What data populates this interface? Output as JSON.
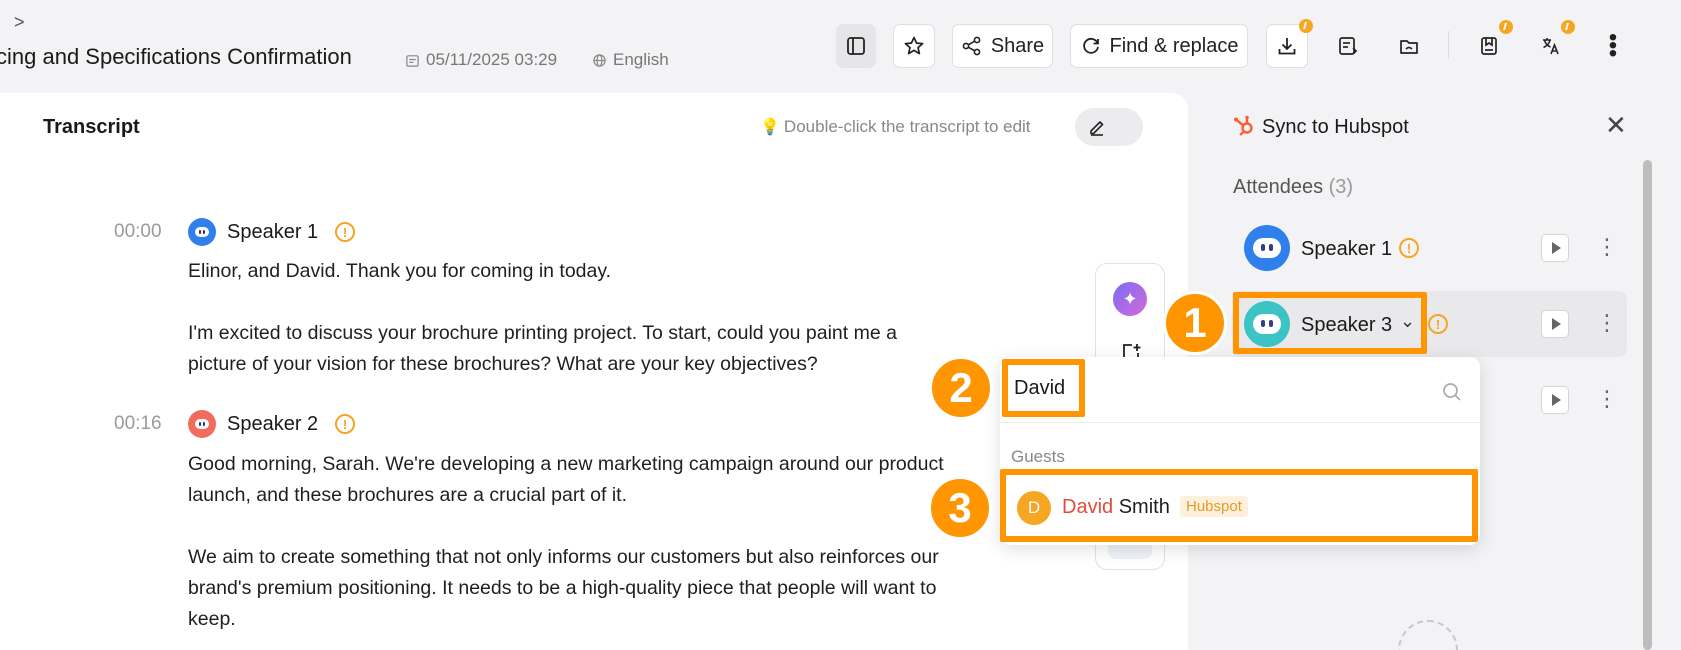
{
  "header": {
    "breadcrumb_chevron": ">",
    "title": "cing and Specifications Confirmation",
    "date": "05/11/2025 03:29",
    "language": "English",
    "share_label": "Share",
    "find_replace_label": "Find & replace"
  },
  "transcript": {
    "title": "Transcript",
    "hint": "Double-click the transcript to edit",
    "entries": [
      {
        "time": "00:00",
        "speaker": "Speaker 1",
        "avatar_color": "#2f80ed",
        "paragraphs": [
          "Elinor, and David. Thank you for coming in today.",
          "I'm excited to discuss your brochure printing project. To start, could you paint me a picture of your vision for these brochures? What are your key objectives?"
        ]
      },
      {
        "time": "00:16",
        "speaker": "Speaker 2",
        "avatar_color": "#f26b5b",
        "paragraphs": [
          "Good morning, Sarah. We're developing a new marketing campaign around our product launch, and these brochures are a crucial part of it.",
          "We aim to create something that not only informs our customers but also reinforces our brand's premium positioning. It needs to be a high-quality piece that people will want to keep."
        ]
      }
    ]
  },
  "sidebar": {
    "title": "Sync to Hubspot",
    "attendees_label": "Attendees",
    "attendees_count": "(3)",
    "attendees": [
      {
        "name": "Speaker 1",
        "avatar_color": "#2f80ed"
      },
      {
        "name": "Speaker 3",
        "avatar_color": "#3cc3c3"
      }
    ]
  },
  "dropdown": {
    "search_value": "David",
    "group_label": "Guests",
    "result_initial": "D",
    "result_match": "David",
    "result_rest": " Smith",
    "result_tag": "Hubspot"
  },
  "annotations": [
    "1",
    "2",
    "3"
  ],
  "colors": {
    "accent_orange": "#ff9500",
    "warning": "#f5a623",
    "match_red": "#e24c3b",
    "hubspot_orange": "#ff5c35"
  }
}
